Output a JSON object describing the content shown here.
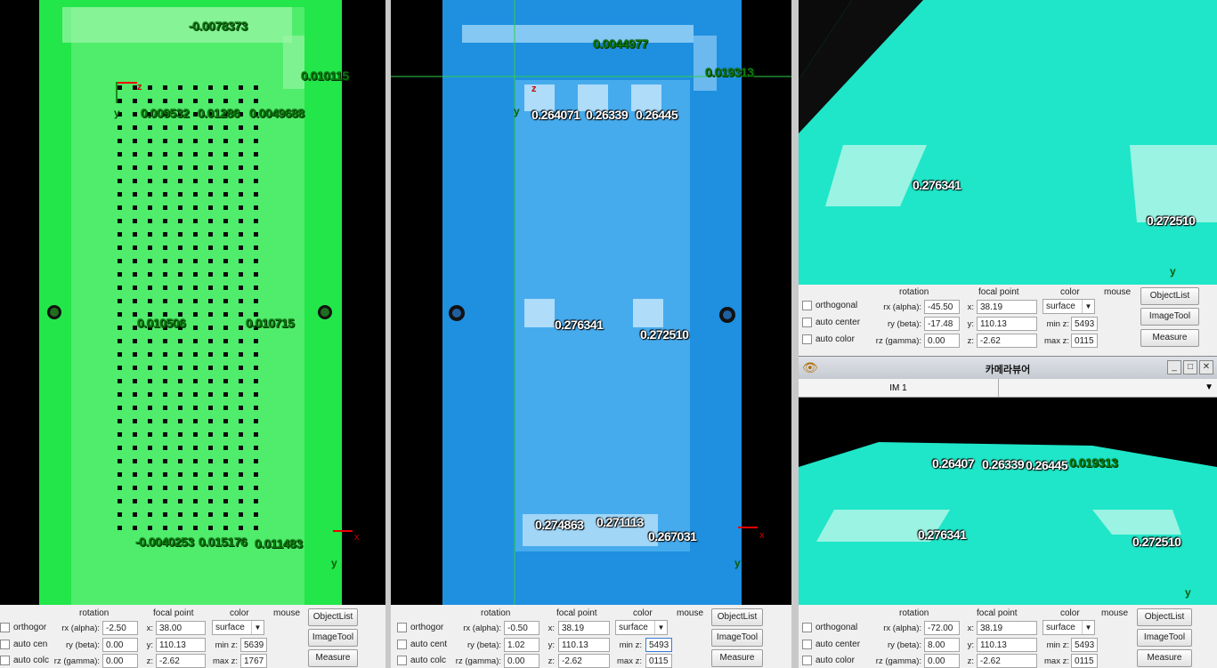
{
  "views": {
    "a": {
      "labels": [
        "-0.0078373",
        "0.010115",
        "0.009532",
        "0.01286",
        "0.0049688",
        "0.010506",
        "0.010715",
        "-0.0040253",
        "0.015176",
        "0.011483"
      ],
      "axis": {
        "x": "x",
        "y": "y",
        "z": "z"
      }
    },
    "b": {
      "labels": [
        "0.0044977",
        "0.019313",
        "0.264071",
        "0.26339",
        "0.26445",
        "0.276341",
        "0.272510",
        "0.274863",
        "0.271113",
        "0.267031"
      ],
      "axis": {
        "x": "x",
        "y": "y",
        "z": "z"
      }
    },
    "c": {
      "labels": [
        "0.276341",
        "0.272510"
      ],
      "axis": {
        "y": "y"
      }
    },
    "d": {
      "labels": [
        "0.26407",
        "0.26339",
        "0.26445",
        "0.019313",
        "0.276341",
        "0.272510"
      ],
      "axis": {
        "y": "y"
      }
    }
  },
  "panels": {
    "a": {
      "checkboxes": [
        "orthogor",
        "auto cen",
        "auto colc"
      ],
      "headers": {
        "rotation": "rotation",
        "focal": "focal point",
        "color": "color",
        "mouse": "mouse"
      },
      "rot_labels": [
        "rx (alpha):",
        "ry (beta):",
        "rz (gamma):"
      ],
      "rot_values": [
        "-2.50",
        "0.00",
        "0.00"
      ],
      "focal_labels": [
        "x:",
        "y:",
        "z:"
      ],
      "focal_values": [
        "38.00",
        "110.13",
        "-2.62"
      ],
      "color_mode": "surface",
      "min_label": "min z:",
      "min_value": "5639",
      "max_label": "max z:",
      "max_value": "1767",
      "buttons": [
        "ObjectList",
        "ImageTool",
        "Measure"
      ]
    },
    "b": {
      "checkboxes": [
        "orthogor",
        "auto cent",
        "auto colc"
      ],
      "headers": {
        "rotation": "rotation",
        "focal": "focal point",
        "color": "color",
        "mouse": "mouse"
      },
      "rot_labels": [
        "rx (alpha):",
        "ry (beta):",
        "rz (gamma):"
      ],
      "rot_values": [
        "-0.50",
        "1.02",
        "0.00"
      ],
      "focal_labels": [
        "x:",
        "y:",
        "z:"
      ],
      "focal_values": [
        "38.19",
        "110.13",
        "-2.62"
      ],
      "color_mode": "surface",
      "min_label": "min z:",
      "min_value": "5493",
      "max_label": "max z:",
      "max_value": "0115",
      "buttons": [
        "ObjectList",
        "ImageTool",
        "Measure"
      ]
    },
    "c": {
      "checkboxes": [
        "orthogonal",
        "auto center",
        "auto color"
      ],
      "headers": {
        "rotation": "rotation",
        "focal": "focal point",
        "color": "color",
        "mouse": "mouse"
      },
      "rot_labels": [
        "rx (alpha):",
        "ry (beta):",
        "rz (gamma):"
      ],
      "rot_values": [
        "-45.50",
        "-17.48",
        "0.00"
      ],
      "focal_labels": [
        "x:",
        "y:",
        "z:"
      ],
      "focal_values": [
        "38.19",
        "110.13",
        "-2.62"
      ],
      "color_mode": "surface",
      "min_label": "min z:",
      "min_value": "5493",
      "max_label": "max z:",
      "max_value": "0115",
      "buttons": [
        "ObjectList",
        "ImageTool",
        "Measure"
      ]
    },
    "d": {
      "checkboxes": [
        "orthogonal",
        "auto center",
        "auto color"
      ],
      "headers": {
        "rotation": "rotation",
        "focal": "focal point",
        "color": "color",
        "mouse": "mouse"
      },
      "rot_labels": [
        "rx (alpha):",
        "ry (beta):",
        "rz (gamma):"
      ],
      "rot_values": [
        "-72.00",
        "8.00",
        "0.00"
      ],
      "focal_labels": [
        "x:",
        "y:",
        "z:"
      ],
      "focal_values": [
        "38.19",
        "110.13",
        "-2.62"
      ],
      "color_mode": "surface",
      "min_label": "min z:",
      "min_value": "5493",
      "max_label": "max z:",
      "max_value": "0115",
      "buttons": [
        "ObjectList",
        "ImageTool",
        "Measure"
      ]
    }
  },
  "camera_window": {
    "title": "카메라뷰어",
    "tab": "IM 1",
    "controls": {
      "minimize": "_",
      "maximize": "□",
      "close": "✕",
      "tab_menu": "▼"
    }
  },
  "colors": {
    "view_a": "#22e64a",
    "view_b": "#1f8fe0",
    "view_cd": "#1fe6c8",
    "label_green": "#0b7a0b"
  }
}
